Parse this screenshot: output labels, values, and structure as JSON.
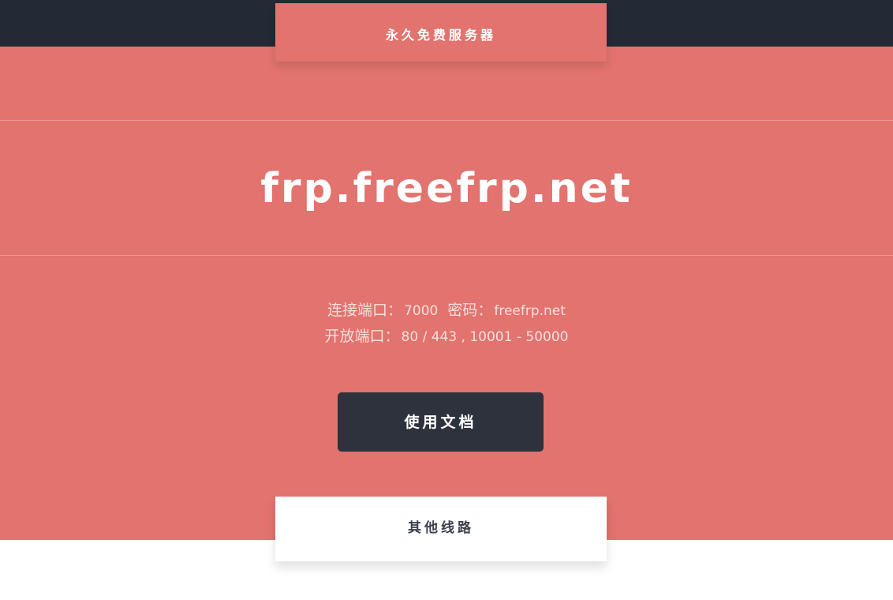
{
  "header": {
    "tab_label": "永久免费服务器"
  },
  "hero": {
    "domain": "frp.freefrp.net",
    "connect_port_label": "连接端口：",
    "connect_port_value": "7000",
    "password_label": "密码：",
    "password_value": "freefrp.net",
    "open_ports_label": "开放端口：",
    "open_ports_value": "80 / 443 , 10001 - 50000",
    "docs_button_label": "使用文档"
  },
  "footer": {
    "tab_label": "其他线路"
  },
  "colors": {
    "hero_background": "#e2736e",
    "top_bar": "#242a35",
    "button_background": "#2d323d",
    "tab_white": "#ffffff"
  }
}
